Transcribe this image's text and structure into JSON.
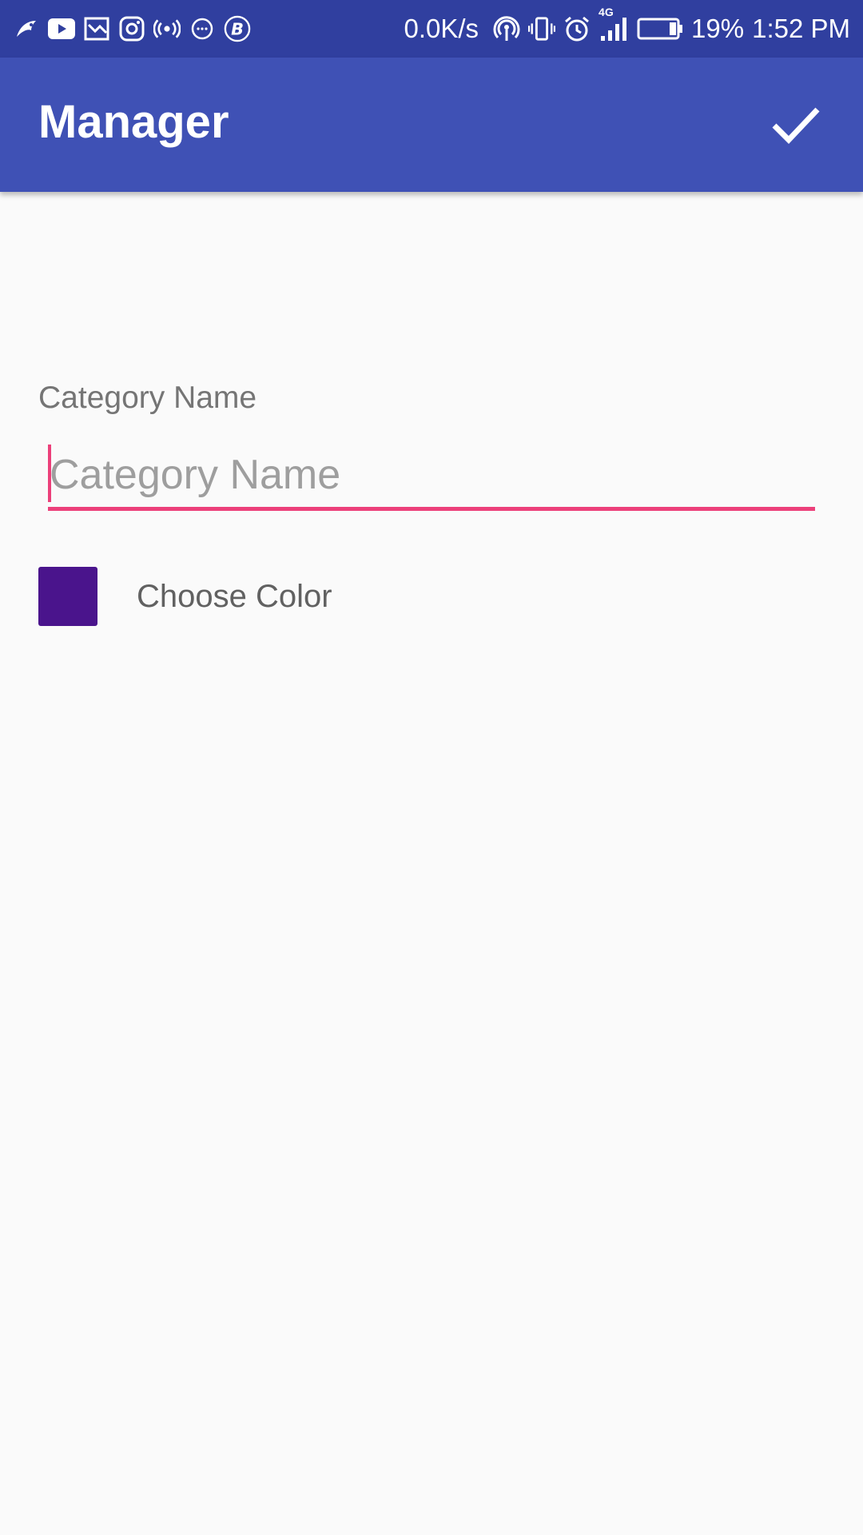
{
  "status_bar": {
    "network_speed": "0.0K/s",
    "network_type": "4G",
    "battery": "19%",
    "time": "1:52 PM",
    "left_icons": [
      "bird-icon",
      "youtube-icon",
      "cast-icon",
      "instagram-icon",
      "radio-icon",
      "chat-icon",
      "b-coin-icon"
    ],
    "right_icons": [
      "hotspot-icon",
      "vibrate-icon",
      "alarm-icon",
      "signal-icon",
      "battery-icon"
    ]
  },
  "app_bar": {
    "title": "Manager",
    "action_icon": "check-icon"
  },
  "form": {
    "category_label": "Category Name",
    "category_placeholder": "Category Name",
    "category_value": "",
    "color_label": "Choose Color",
    "selected_color": "#4a148c"
  },
  "colors": {
    "status_bar": "#303f9f",
    "primary": "#3f51b5",
    "accent": "#ec407a",
    "background": "#fafafa"
  }
}
